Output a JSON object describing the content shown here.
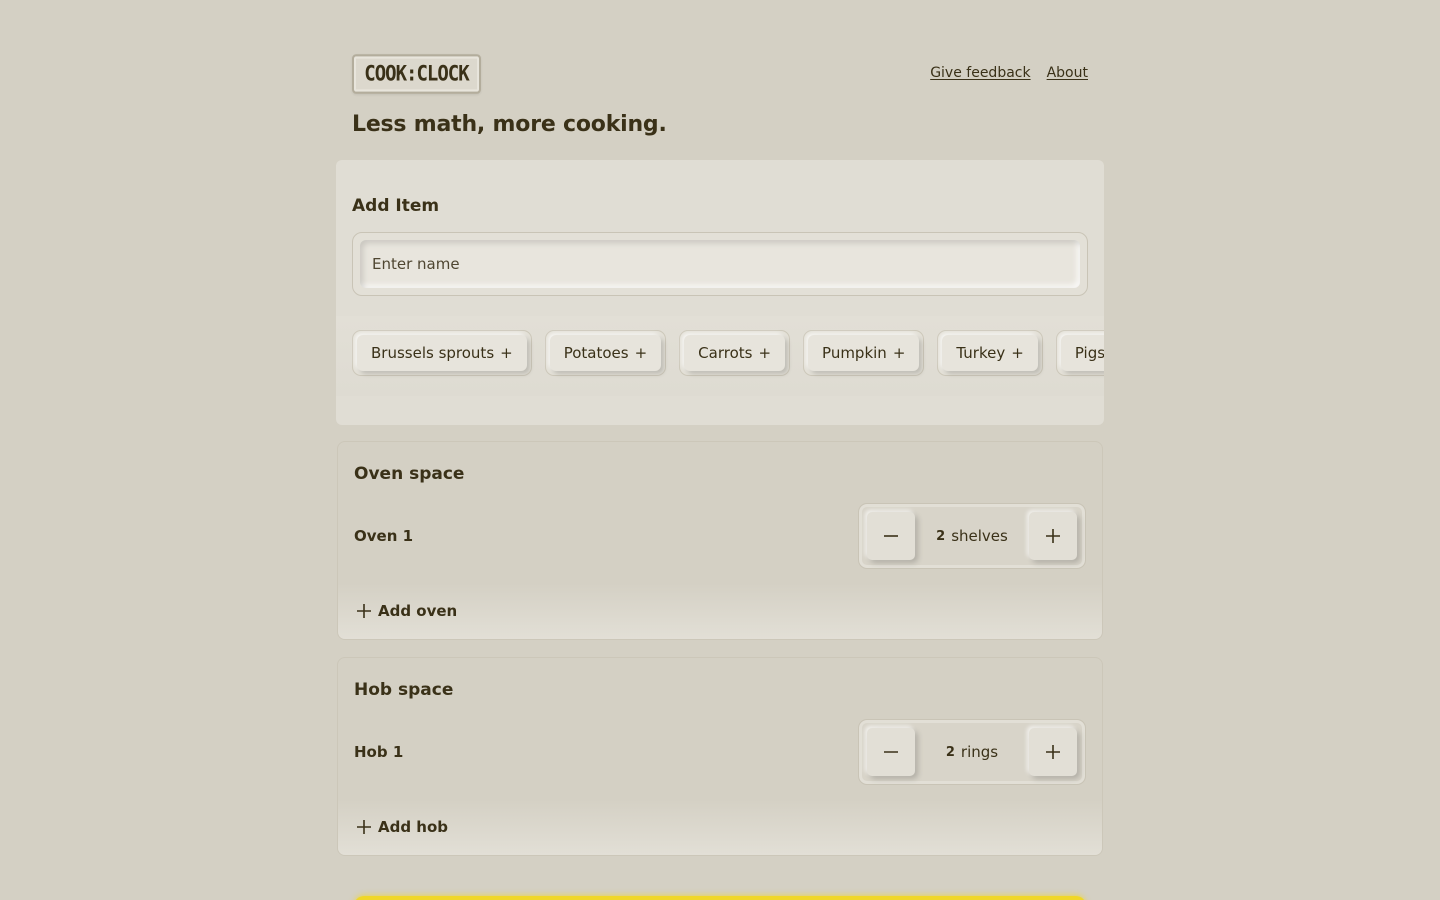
{
  "header": {
    "logo_text": "COOK:CLOCK",
    "nav": {
      "feedback": "Give feedback",
      "about": "About"
    }
  },
  "tagline": "Less math, more cooking.",
  "add_item": {
    "title": "Add Item",
    "input": {
      "placeholder": "Enter name",
      "value": ""
    },
    "suggestions": [
      {
        "label": "Brussels sprouts"
      },
      {
        "label": "Potatoes"
      },
      {
        "label": "Carrots"
      },
      {
        "label": "Pumpkin"
      },
      {
        "label": "Turkey"
      },
      {
        "label": "Pigs In"
      }
    ],
    "suggestion_suffix": "+"
  },
  "oven_space": {
    "title": "Oven space",
    "items": [
      {
        "label": "Oven 1",
        "count": "2",
        "unit": "shelves"
      }
    ],
    "add_label": "Add oven"
  },
  "hob_space": {
    "title": "Hob space",
    "items": [
      {
        "label": "Hob 1",
        "count": "2",
        "unit": "rings"
      }
    ],
    "add_label": "Add hob"
  },
  "colors": {
    "background": "#d4d0c4",
    "text": "#3a3118",
    "accent": "#f0d728"
  }
}
